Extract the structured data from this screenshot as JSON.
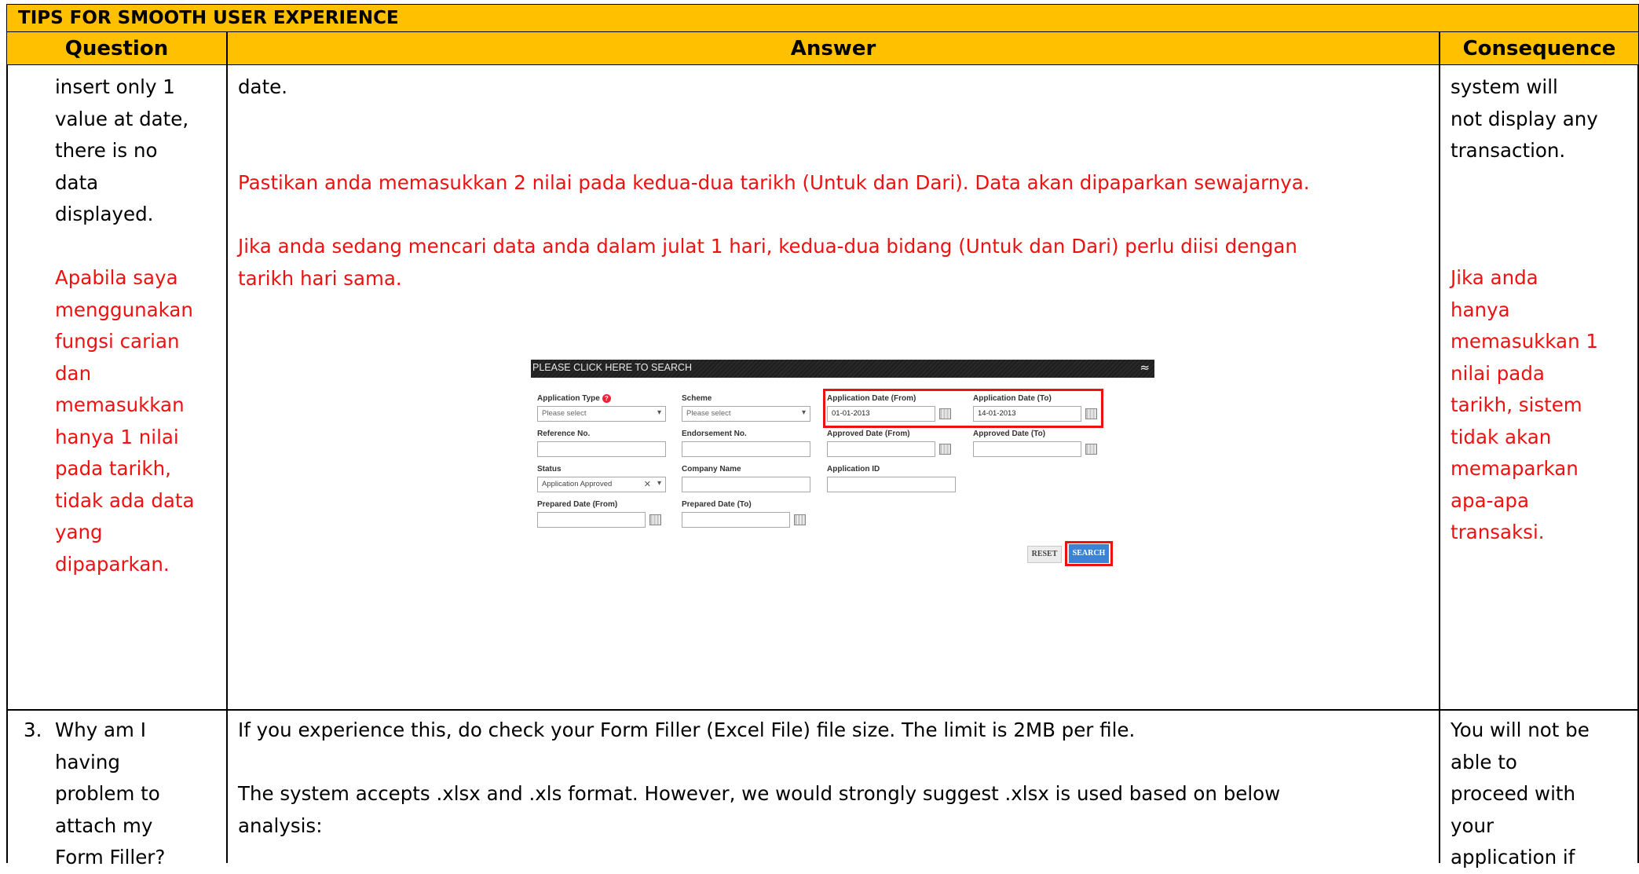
{
  "title": "TIPS FOR SMOOTH USER EXPERIENCE",
  "headers": {
    "question": "Question",
    "answer": "Answer",
    "consequence": "Consequence"
  },
  "row2": {
    "question_en": "insert only 1\nvalue at date,\nthere is no\ndata\ndisplayed.",
    "question_ms": "Apabila saya\nmenggunakan\nfungsi carian\ndan\nmemasukkan\nhanya 1 nilai\npada tarikh,\ntidak ada data\nyang\ndipaparkan.",
    "answer_en": "date.",
    "answer_ms_1": "Pastikan anda memasukkan 2 nilai pada kedua-dua tarikh (Untuk dan Dari). Data akan dipaparkan sewajarnya.",
    "answer_ms_2": "Jika anda sedang mencari data anda dalam julat 1 hari, kedua-dua bidang (Untuk dan Dari) perlu diisi dengan\ntarikh hari sama.",
    "consequence_en": "system  will\nnot display any\ntransaction.",
    "consequence_ms": "Jika anda\nhanya\nmemasukkan 1\nnilai pada\ntarikh, sistem\ntidak akan\nmemaparkan\napa-apa\ntransaksi."
  },
  "search_panel": {
    "bar_title": "PLEASE CLICK HERE TO SEARCH",
    "collapse_glyph": "≈",
    "labels": {
      "application_type": "Application Type",
      "scheme": "Scheme",
      "app_date_from": "Application Date (From)",
      "app_date_to": "Application Date (To)",
      "reference_no": "Reference No.",
      "endorsement_no": "Endorsement No.",
      "approved_from": "Approved Date (From)",
      "approved_to": "Approved Date (To)",
      "status": "Status",
      "company_name": "Company Name",
      "application_id": "Application ID",
      "prepared_from": "Prepared Date (From)",
      "prepared_to": "Prepared Date (To)"
    },
    "values": {
      "application_type": "Please select",
      "scheme": "Please select",
      "app_date_from": "01-01-2013",
      "app_date_to": "14-01-2013",
      "status": "Application Approved"
    },
    "reset_label": "RESET",
    "search_label": "SEARCH"
  },
  "row3": {
    "number": "3.",
    "question": "Why am I\nhaving\nproblem to\nattach my\nForm Filler?",
    "answer_1": "If you experience this, do check your Form Filler (Excel File) file size. The limit is 2MB per file.",
    "answer_2": "The system accepts .xlsx and .xls format. However, we would strongly suggest .xlsx is used based on below\nanalysis:",
    "consequence": "You will not be\nable to\nproceed with\nyour\napplication if"
  }
}
